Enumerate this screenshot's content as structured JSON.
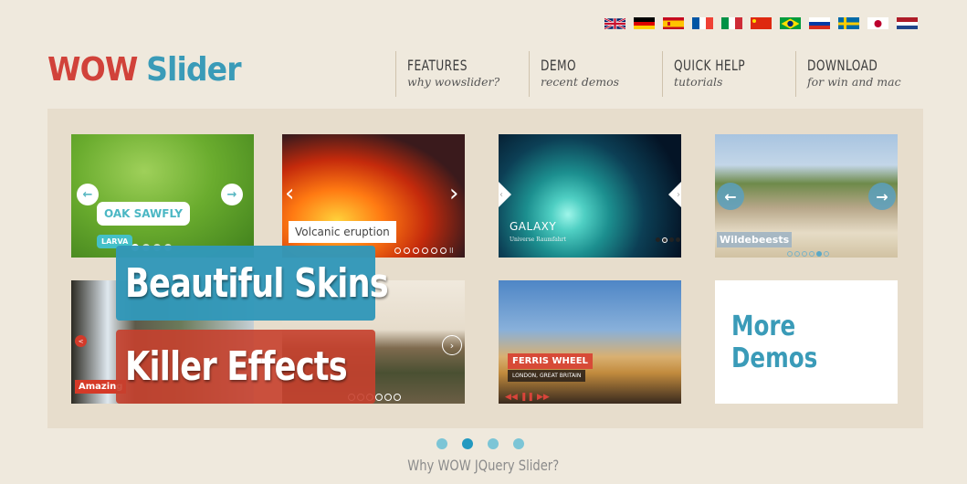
{
  "languages": [
    {
      "code": "en",
      "name": "English",
      "icon": "uk-flag-icon"
    },
    {
      "code": "de",
      "name": "German",
      "icon": "germany-flag-icon"
    },
    {
      "code": "es",
      "name": "Spanish",
      "icon": "spain-flag-icon"
    },
    {
      "code": "fr",
      "name": "French",
      "icon": "france-flag-icon"
    },
    {
      "code": "it",
      "name": "Italian",
      "icon": "italy-flag-icon"
    },
    {
      "code": "zh",
      "name": "Chinese",
      "icon": "china-flag-icon"
    },
    {
      "code": "pt",
      "name": "Portuguese",
      "icon": "brazil-flag-icon"
    },
    {
      "code": "ru",
      "name": "Russian",
      "icon": "russia-flag-icon"
    },
    {
      "code": "sv",
      "name": "Swedish",
      "icon": "sweden-flag-icon"
    },
    {
      "code": "ja",
      "name": "Japanese",
      "icon": "japan-flag-icon"
    },
    {
      "code": "nl",
      "name": "Dutch",
      "icon": "netherlands-flag-icon"
    }
  ],
  "logo": {
    "part1": "WOW",
    "part2": "Slider"
  },
  "nav": [
    {
      "title": "FEATURES",
      "subtitle": "why wowslider?"
    },
    {
      "title": "DEMO",
      "subtitle": "recent demos"
    },
    {
      "title": "QUICK HELP",
      "subtitle": "tutorials"
    },
    {
      "title": "DOWNLOAD",
      "subtitle": "for win and mac"
    }
  ],
  "demos": {
    "oak": {
      "caption": "OAK SAWFLY",
      "tag": "LARVA",
      "prev": "←",
      "next": "→"
    },
    "volcano": {
      "caption": "Volcanic eruption",
      "prev": "‹",
      "next": "›",
      "pause": "II"
    },
    "galaxy": {
      "caption": "GALAXY",
      "subtitle": "Universe Raumfahrt",
      "prev": "‹",
      "next": "›"
    },
    "wildebeest": {
      "caption": "Wildebeests",
      "prev": "←",
      "next": "→"
    },
    "waterfall": {
      "caption": "Amazing",
      "share": "<"
    },
    "castle": {
      "next": "›"
    },
    "ferris": {
      "caption": "FERRIS WHEEL",
      "subtitle": "LONDON, GREAT BRITAIN",
      "rewind": "◀◀",
      "pause": "❚❚",
      "forward": "▶▶"
    },
    "more": {
      "label": "More Demos"
    }
  },
  "overlays": {
    "skins": "Beautiful Skins",
    "effects": "Killer Effects"
  },
  "pager": {
    "count": 4,
    "active_index": 1
  },
  "why_link": "Why WOW JQuery Slider?",
  "colors": {
    "brand_red": "#d1423a",
    "brand_blue": "#3a9bb8",
    "background": "#efe9dd",
    "stage": "#e7ddcc"
  }
}
